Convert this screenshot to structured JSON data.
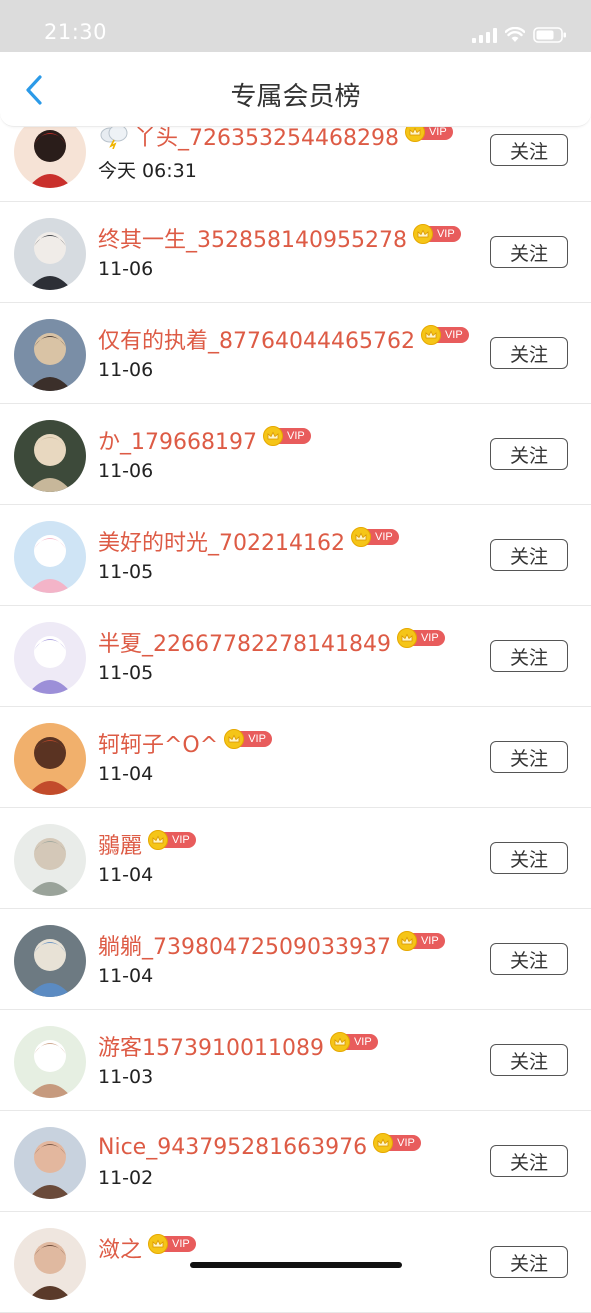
{
  "status": {
    "time": "21:30"
  },
  "header": {
    "title": "专属会员榜",
    "back_icon": "chevron-left-icon"
  },
  "accent_color": "#dd5b45",
  "vip_label": "VIP",
  "follow_label": "关注",
  "members": [
    {
      "name": "丫头_726353254468298",
      "date": "今天 06:31",
      "prefix_icon": "cloud-lightning-icon"
    },
    {
      "name": "终其一生_352858140955278",
      "date": "11-06"
    },
    {
      "name": "仅有的执着_87764044465762",
      "date": "11-06"
    },
    {
      "name": "か_179668197",
      "date": "11-06"
    },
    {
      "name": "美好的时光_702214162",
      "date": "11-05"
    },
    {
      "name": "半夏_22667782278141849",
      "date": "11-05"
    },
    {
      "name": "轲轲子^O^",
      "date": "11-04"
    },
    {
      "name": "鶸麗",
      "date": "11-04"
    },
    {
      "name": "躺躺_73980472509033937",
      "date": "11-04"
    },
    {
      "name": "游客1573910011089",
      "date": "11-03"
    },
    {
      "name": "Nice_943795281663976",
      "date": "11-02"
    },
    {
      "name": "潋之",
      "date": ""
    }
  ]
}
